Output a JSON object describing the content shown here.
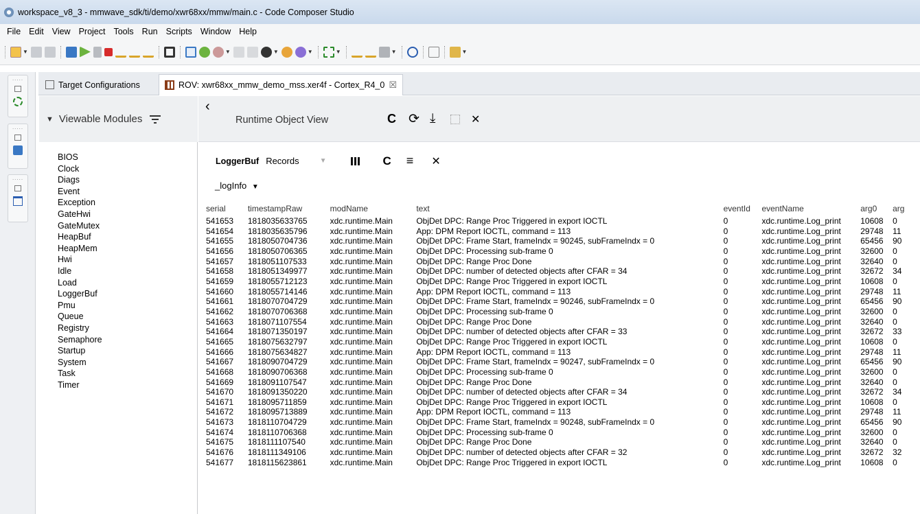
{
  "window": {
    "title": "workspace_v8_3 - mmwave_sdk/ti/demo/xwr68xx/mmw/main.c - Code Composer Studio"
  },
  "menu": [
    "File",
    "Edit",
    "View",
    "Project",
    "Tools",
    "Run",
    "Scripts",
    "Window",
    "Help"
  ],
  "tabs": {
    "target": "Target Configurations",
    "rov": "ROV: xwr68xx_mmw_demo_mss.xer4f - Cortex_R4_0",
    "close_glyph": "☒"
  },
  "modules_header": {
    "title": "Viewable Modules"
  },
  "modules": [
    "BIOS",
    "Clock",
    "Diags",
    "Event",
    "Exception",
    "GateHwi",
    "GateMutex",
    "HeapBuf",
    "HeapMem",
    "Hwi",
    "Idle",
    "Load",
    "LoggerBuf",
    "Pmu",
    "Queue",
    "Registry",
    "Semaphore",
    "Startup",
    "System",
    "Task",
    "Timer"
  ],
  "rov": {
    "title": "Runtime Object View",
    "back": "‹",
    "refresh": "C",
    "repeat": "⟳",
    "download": "⤓",
    "close": "✕"
  },
  "logger": {
    "module": "LoggerBuf",
    "view": "Records",
    "instance": "_logInfo"
  },
  "table": {
    "columns": [
      "serial",
      "timestampRaw",
      "modName",
      "text",
      "eventId",
      "eventName",
      "arg0",
      "arg"
    ],
    "rows": [
      [
        "541653",
        "1818035633765",
        "xdc.runtime.Main",
        "ObjDet DPC: Range Proc Triggered in export IOCTL",
        "0",
        "xdc.runtime.Log_print",
        "10608",
        "0"
      ],
      [
        "541654",
        "1818035635796",
        "xdc.runtime.Main",
        "App: DPM Report IOCTL, command = 113",
        "0",
        "xdc.runtime.Log_print",
        "29748",
        "11"
      ],
      [
        "541655",
        "1818050704736",
        "xdc.runtime.Main",
        "ObjDet DPC: Frame Start, frameIndx = 90245, subFrameIndx = 0",
        "0",
        "xdc.runtime.Log_print",
        "65456",
        "90"
      ],
      [
        "541656",
        "1818050706365",
        "xdc.runtime.Main",
        "ObjDet DPC: Processing sub-frame 0",
        "0",
        "xdc.runtime.Log_print",
        "32600",
        "0"
      ],
      [
        "541657",
        "1818051107533",
        "xdc.runtime.Main",
        "ObjDet DPC: Range Proc Done",
        "0",
        "xdc.runtime.Log_print",
        "32640",
        "0"
      ],
      [
        "541658",
        "1818051349977",
        "xdc.runtime.Main",
        "ObjDet DPC: number of detected objects after CFAR = 34",
        "0",
        "xdc.runtime.Log_print",
        "32672",
        "34"
      ],
      [
        "541659",
        "1818055712123",
        "xdc.runtime.Main",
        "ObjDet DPC: Range Proc Triggered in export IOCTL",
        "0",
        "xdc.runtime.Log_print",
        "10608",
        "0"
      ],
      [
        "541660",
        "1818055714146",
        "xdc.runtime.Main",
        "App: DPM Report IOCTL, command = 113",
        "0",
        "xdc.runtime.Log_print",
        "29748",
        "11"
      ],
      [
        "541661",
        "1818070704729",
        "xdc.runtime.Main",
        "ObjDet DPC: Frame Start, frameIndx = 90246, subFrameIndx = 0",
        "0",
        "xdc.runtime.Log_print",
        "65456",
        "90"
      ],
      [
        "541662",
        "1818070706368",
        "xdc.runtime.Main",
        "ObjDet DPC: Processing sub-frame 0",
        "0",
        "xdc.runtime.Log_print",
        "32600",
        "0"
      ],
      [
        "541663",
        "1818071107554",
        "xdc.runtime.Main",
        "ObjDet DPC: Range Proc Done",
        "0",
        "xdc.runtime.Log_print",
        "32640",
        "0"
      ],
      [
        "541664",
        "1818071350197",
        "xdc.runtime.Main",
        "ObjDet DPC: number of detected objects after CFAR = 33",
        "0",
        "xdc.runtime.Log_print",
        "32672",
        "33"
      ],
      [
        "541665",
        "1818075632797",
        "xdc.runtime.Main",
        "ObjDet DPC: Range Proc Triggered in export IOCTL",
        "0",
        "xdc.runtime.Log_print",
        "10608",
        "0"
      ],
      [
        "541666",
        "1818075634827",
        "xdc.runtime.Main",
        "App: DPM Report IOCTL, command = 113",
        "0",
        "xdc.runtime.Log_print",
        "29748",
        "11"
      ],
      [
        "541667",
        "1818090704729",
        "xdc.runtime.Main",
        "ObjDet DPC: Frame Start, frameIndx = 90247, subFrameIndx = 0",
        "0",
        "xdc.runtime.Log_print",
        "65456",
        "90"
      ],
      [
        "541668",
        "1818090706368",
        "xdc.runtime.Main",
        "ObjDet DPC: Processing sub-frame 0",
        "0",
        "xdc.runtime.Log_print",
        "32600",
        "0"
      ],
      [
        "541669",
        "1818091107547",
        "xdc.runtime.Main",
        "ObjDet DPC: Range Proc Done",
        "0",
        "xdc.runtime.Log_print",
        "32640",
        "0"
      ],
      [
        "541670",
        "1818091350220",
        "xdc.runtime.Main",
        "ObjDet DPC: number of detected objects after CFAR = 34",
        "0",
        "xdc.runtime.Log_print",
        "32672",
        "34"
      ],
      [
        "541671",
        "1818095711859",
        "xdc.runtime.Main",
        "ObjDet DPC: Range Proc Triggered in export IOCTL",
        "0",
        "xdc.runtime.Log_print",
        "10608",
        "0"
      ],
      [
        "541672",
        "1818095713889",
        "xdc.runtime.Main",
        "App: DPM Report IOCTL, command = 113",
        "0",
        "xdc.runtime.Log_print",
        "29748",
        "11"
      ],
      [
        "541673",
        "1818110704729",
        "xdc.runtime.Main",
        "ObjDet DPC: Frame Start, frameIndx = 90248, subFrameIndx = 0",
        "0",
        "xdc.runtime.Log_print",
        "65456",
        "90"
      ],
      [
        "541674",
        "1818110706368",
        "xdc.runtime.Main",
        "ObjDet DPC: Processing sub-frame 0",
        "0",
        "xdc.runtime.Log_print",
        "32600",
        "0"
      ],
      [
        "541675",
        "1818111107540",
        "xdc.runtime.Main",
        "ObjDet DPC: Range Proc Done",
        "0",
        "xdc.runtime.Log_print",
        "32640",
        "0"
      ],
      [
        "541676",
        "1818111349106",
        "xdc.runtime.Main",
        "ObjDet DPC: number of detected objects after CFAR = 32",
        "0",
        "xdc.runtime.Log_print",
        "32672",
        "32"
      ],
      [
        "541677",
        "1818115623861",
        "xdc.runtime.Main",
        "ObjDet DPC: Range Proc Triggered in export IOCTL",
        "0",
        "xdc.runtime.Log_print",
        "10608",
        "0"
      ]
    ]
  },
  "colors": {
    "titlebar": "#c9d9ec",
    "header_bg": "#eef0f2",
    "accent_blue": "#2b63b0"
  }
}
